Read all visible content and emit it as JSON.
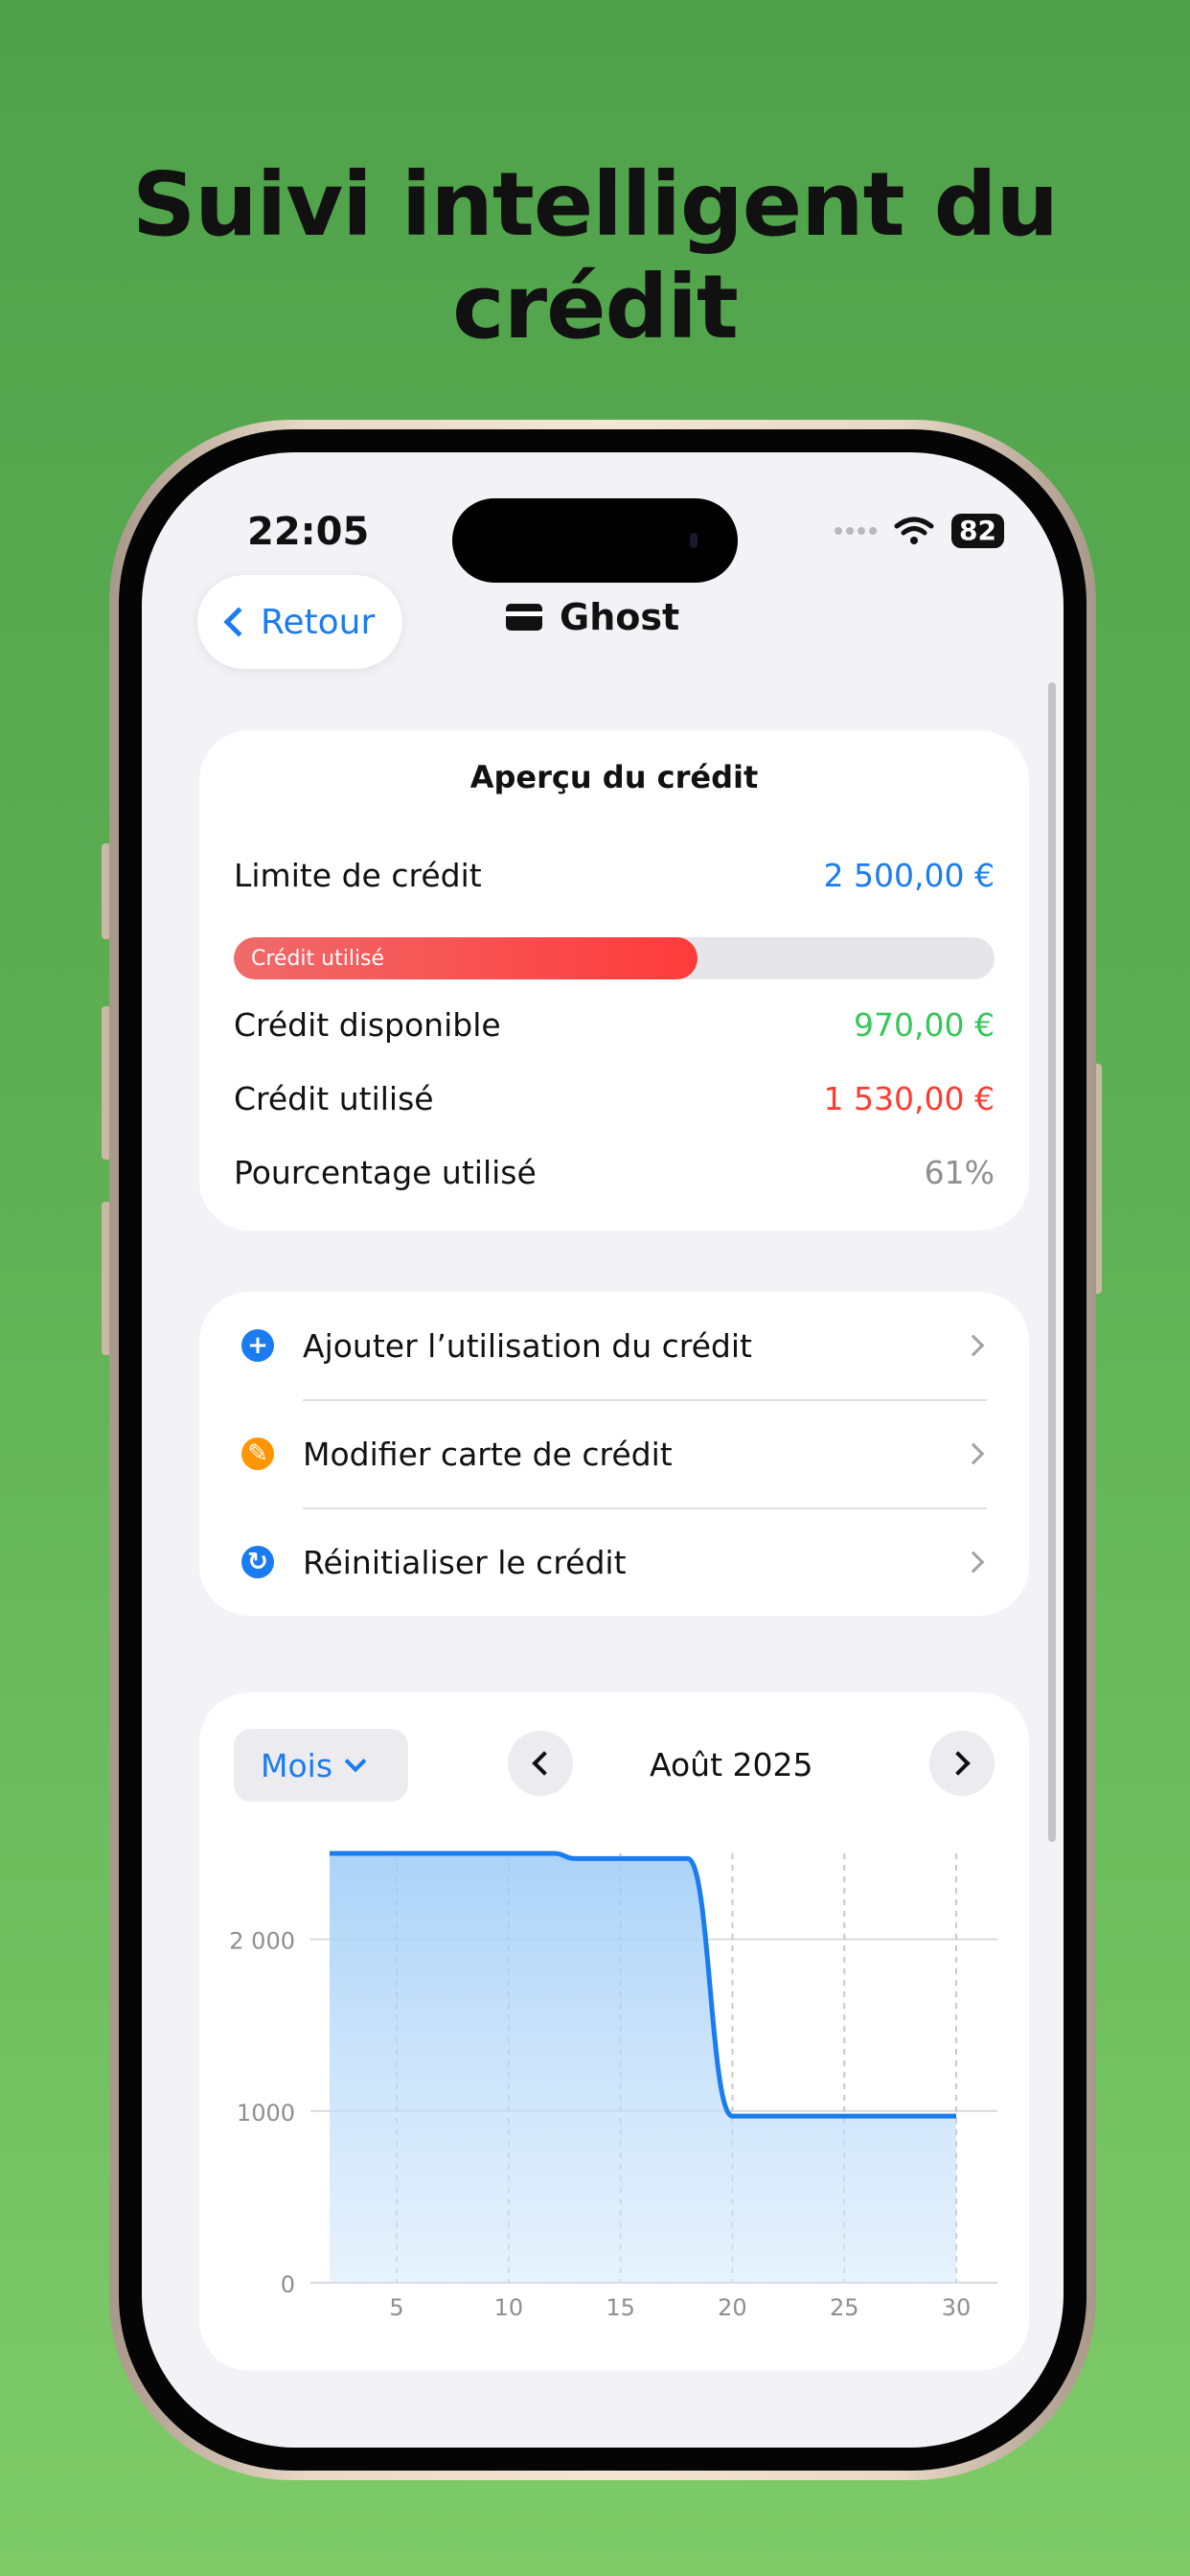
{
  "headline": "Suivi intelligent du crédit",
  "status": {
    "time": "22:05",
    "battery": "82"
  },
  "nav": {
    "back_label": "Retour",
    "title": "Ghost"
  },
  "overview": {
    "title": "Aperçu du crédit",
    "limit_label": "Limite de crédit",
    "limit_value": "2 500,00 €",
    "bar_label": "Crédit utilisé",
    "bar_fraction": 0.61,
    "available_label": "Crédit disponible",
    "available_value": "970,00 €",
    "used_label": "Crédit utilisé",
    "used_value": "1 530,00 €",
    "percent_label": "Pourcentage utilisé",
    "percent_value": "61%"
  },
  "actions": [
    {
      "label": "Ajouter l’utilisation du crédit",
      "icon": "plus-icon",
      "glyph": "+",
      "color": "#1a7cf0"
    },
    {
      "label": "Modifier carte de crédit",
      "icon": "pencil-icon",
      "glyph": "✎",
      "color": "#ff9500"
    },
    {
      "label": "Réinitialiser le crédit",
      "icon": "reset-icon",
      "glyph": "↻",
      "color": "#1a7cf0"
    }
  ],
  "chart_header": {
    "period_label": "Mois",
    "month": "Août 2025"
  },
  "chart_data": {
    "type": "area",
    "x": [
      2,
      12,
      13,
      14,
      18,
      20,
      30
    ],
    "y": [
      2500,
      2500,
      2470,
      2470,
      2470,
      970,
      970
    ],
    "xticks": [
      "5",
      "10",
      "15",
      "20",
      "25",
      "30"
    ],
    "yticks": [
      "0",
      "1000",
      "2 000"
    ],
    "xlim": [
      2,
      30
    ],
    "ylim": [
      0,
      2500
    ],
    "grid": true,
    "line_color": "#1a7cf0"
  }
}
